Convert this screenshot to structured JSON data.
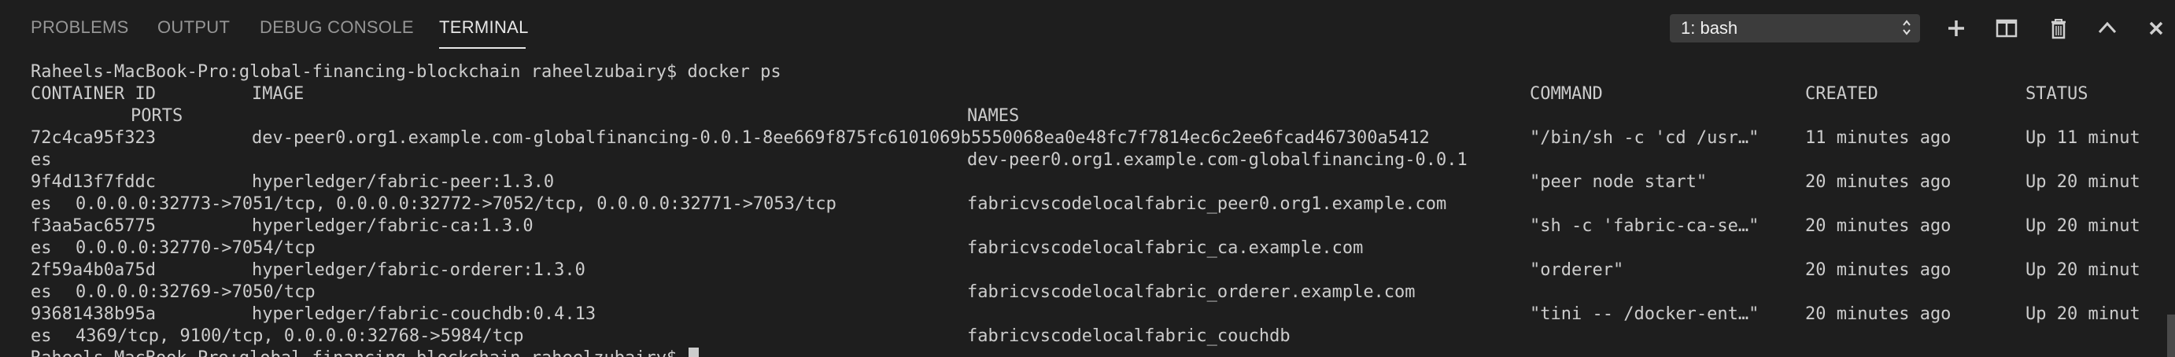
{
  "panel": {
    "tabs": [
      {
        "label": "PROBLEMS"
      },
      {
        "label": "OUTPUT"
      },
      {
        "label": "DEBUG CONSOLE"
      },
      {
        "label": "TERMINAL"
      }
    ],
    "active_tab": "TERMINAL",
    "terminal_selector": "1: bash"
  },
  "terminal": {
    "prompt_line": "Raheels-MacBook-Pro:global-financing-blockchain raheelzubairy$ docker ps",
    "headers": {
      "container_id": "CONTAINER ID",
      "image": "IMAGE",
      "command": "COMMAND",
      "created": "CREATED",
      "status": "STATUS",
      "ports": "PORTS",
      "names": "NAMES"
    },
    "rows": [
      {
        "container_id": "72c4ca95f323",
        "image": "dev-peer0.org1.example.com-globalfinancing-0.0.1-8ee669f875fc6101069b5550068ea0e48fc7f7814ec6c2ee6fcad467300a5412",
        "command": "\"/bin/sh -c 'cd /usr…\"",
        "created": "11 minutes ago",
        "status": "Up 11 minut",
        "status_wrap": "es",
        "ports": "",
        "names": "dev-peer0.org1.example.com-globalfinancing-0.0.1"
      },
      {
        "container_id": "9f4d13f7fddc",
        "image": "hyperledger/fabric-peer:1.3.0",
        "command": "\"peer node start\"",
        "created": "20 minutes ago",
        "status": "Up 20 minut",
        "status_wrap": "es",
        "ports": "0.0.0.0:32773->7051/tcp, 0.0.0.0:32772->7052/tcp, 0.0.0.0:32771->7053/tcp",
        "names": "fabricvscodelocalfabric_peer0.org1.example.com"
      },
      {
        "container_id": "f3aa5ac65775",
        "image": "hyperledger/fabric-ca:1.3.0",
        "command": "\"sh -c 'fabric-ca-se…\"",
        "created": "20 minutes ago",
        "status": "Up 20 minut",
        "status_wrap": "es",
        "ports": "0.0.0.0:32770->7054/tcp",
        "names": "fabricvscodelocalfabric_ca.example.com"
      },
      {
        "container_id": "2f59a4b0a75d",
        "image": "hyperledger/fabric-orderer:1.3.0",
        "command": "\"orderer\"",
        "created": "20 minutes ago",
        "status": "Up 20 minut",
        "status_wrap": "es",
        "ports": "0.0.0.0:32769->7050/tcp",
        "names": "fabricvscodelocalfabric_orderer.example.com"
      },
      {
        "container_id": "93681438b95a",
        "image": "hyperledger/fabric-couchdb:0.4.13",
        "command": "\"tini -- /docker-ent…\"",
        "created": "20 minutes ago",
        "status": "Up 20 minut",
        "status_wrap": "es",
        "ports": "4369/tcp, 9100/tcp, 0.0.0.0:32768->5984/tcp",
        "names": "fabricvscodelocalfabric_couchdb"
      }
    ],
    "last_prompt": "Raheels-MacBook-Pro:global-financing-blockchain raheelzubairy$"
  },
  "icons": {
    "new_terminal": "plus-icon",
    "split_terminal": "split-icon",
    "kill_terminal": "trash-icon",
    "maximize_panel": "chevron-up-icon",
    "close_panel": "close-icon"
  },
  "colors": {
    "background": "#1e1e1e",
    "foreground": "#cccccc",
    "tab_inactive": "#969696",
    "tab_active": "#e7e7e7",
    "dropdown_bg": "#3c3c3c"
  }
}
